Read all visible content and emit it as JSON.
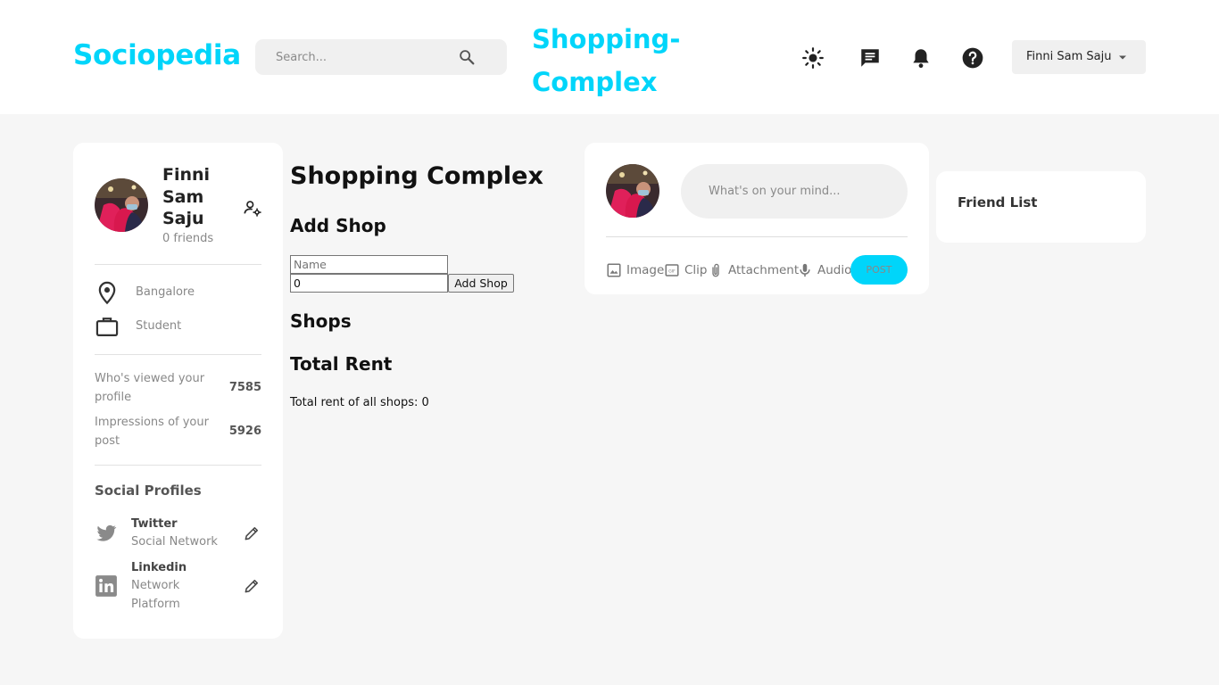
{
  "nav": {
    "brand": "Sociopedia",
    "search_placeholder": "Search...",
    "page_heading": "Shopping-Complex",
    "user_name": "Finni Sam Saju"
  },
  "profile": {
    "name": "Finni Sam Saju",
    "friends": "0 friends",
    "location": "Bangalore",
    "occupation": "Student",
    "stats": [
      {
        "label": "Who's viewed your profile",
        "value": "7585"
      },
      {
        "label": "Impressions of your post",
        "value": "5926"
      }
    ],
    "social_title": "Social Profiles",
    "socials": [
      {
        "name": "Twitter",
        "desc": "Social Network"
      },
      {
        "name": "Linkedin",
        "desc": "Network Platform"
      }
    ]
  },
  "shopping": {
    "title": "Shopping Complex",
    "add_heading": "Add Shop",
    "name_placeholder": "Name",
    "rent_value": "0",
    "add_button": "Add Shop",
    "shops_heading": "Shops",
    "rent_heading": "Total Rent",
    "total_text": "Total rent of all shops: 0"
  },
  "post": {
    "placeholder": "What's on your mind...",
    "tools": [
      "Image",
      "Clip",
      "Attachment",
      "Audio"
    ],
    "post_button": "POST"
  },
  "friends": {
    "title": "Friend List"
  },
  "colors": {
    "accent": "#00d5fa",
    "background": "#f6f6f6",
    "card": "#ffffff"
  }
}
